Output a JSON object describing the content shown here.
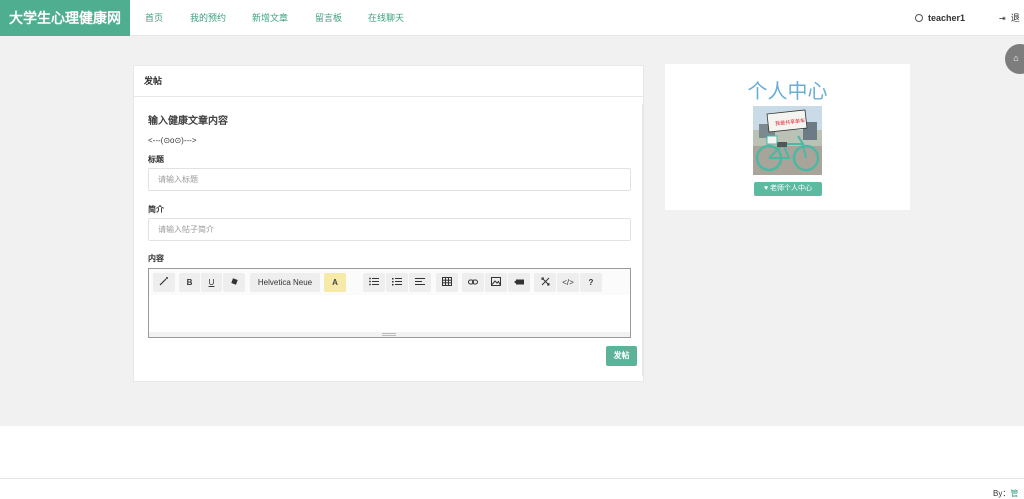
{
  "header": {
    "brand": "大学生心理健康网",
    "nav": [
      "首页",
      "我的预约",
      "新增文章",
      "留言板",
      "在线聊天"
    ],
    "username": "teacher1",
    "logout_label": "退"
  },
  "post": {
    "panel_title": "发帖",
    "section_title": "输入健康文章内容",
    "emoticon": "<---(⊙o⊙)--->",
    "title_label": "标题",
    "title_placeholder": "请输入标题",
    "intro_label": "简介",
    "intro_placeholder": "请输入帖子简介",
    "content_label": "内容",
    "font_name": "Helvetica Neue",
    "toolbar_glyphs": {
      "bold": "B",
      "underline": "U",
      "color": "A",
      "code": "</>",
      "help": "?"
    },
    "submit_label": "发帖"
  },
  "profile": {
    "title": "个人中心",
    "avatar_sign_text": "我是共享单车",
    "badge_label": "老师个人中心"
  },
  "footer": {
    "by_label": "By：",
    "author": "管"
  },
  "colors": {
    "brand": "#4fae8f",
    "nav_text": "#3aa181",
    "submit": "#5cb39a",
    "profile_title": "#6aaed6",
    "badge": "#5bbaa0"
  }
}
